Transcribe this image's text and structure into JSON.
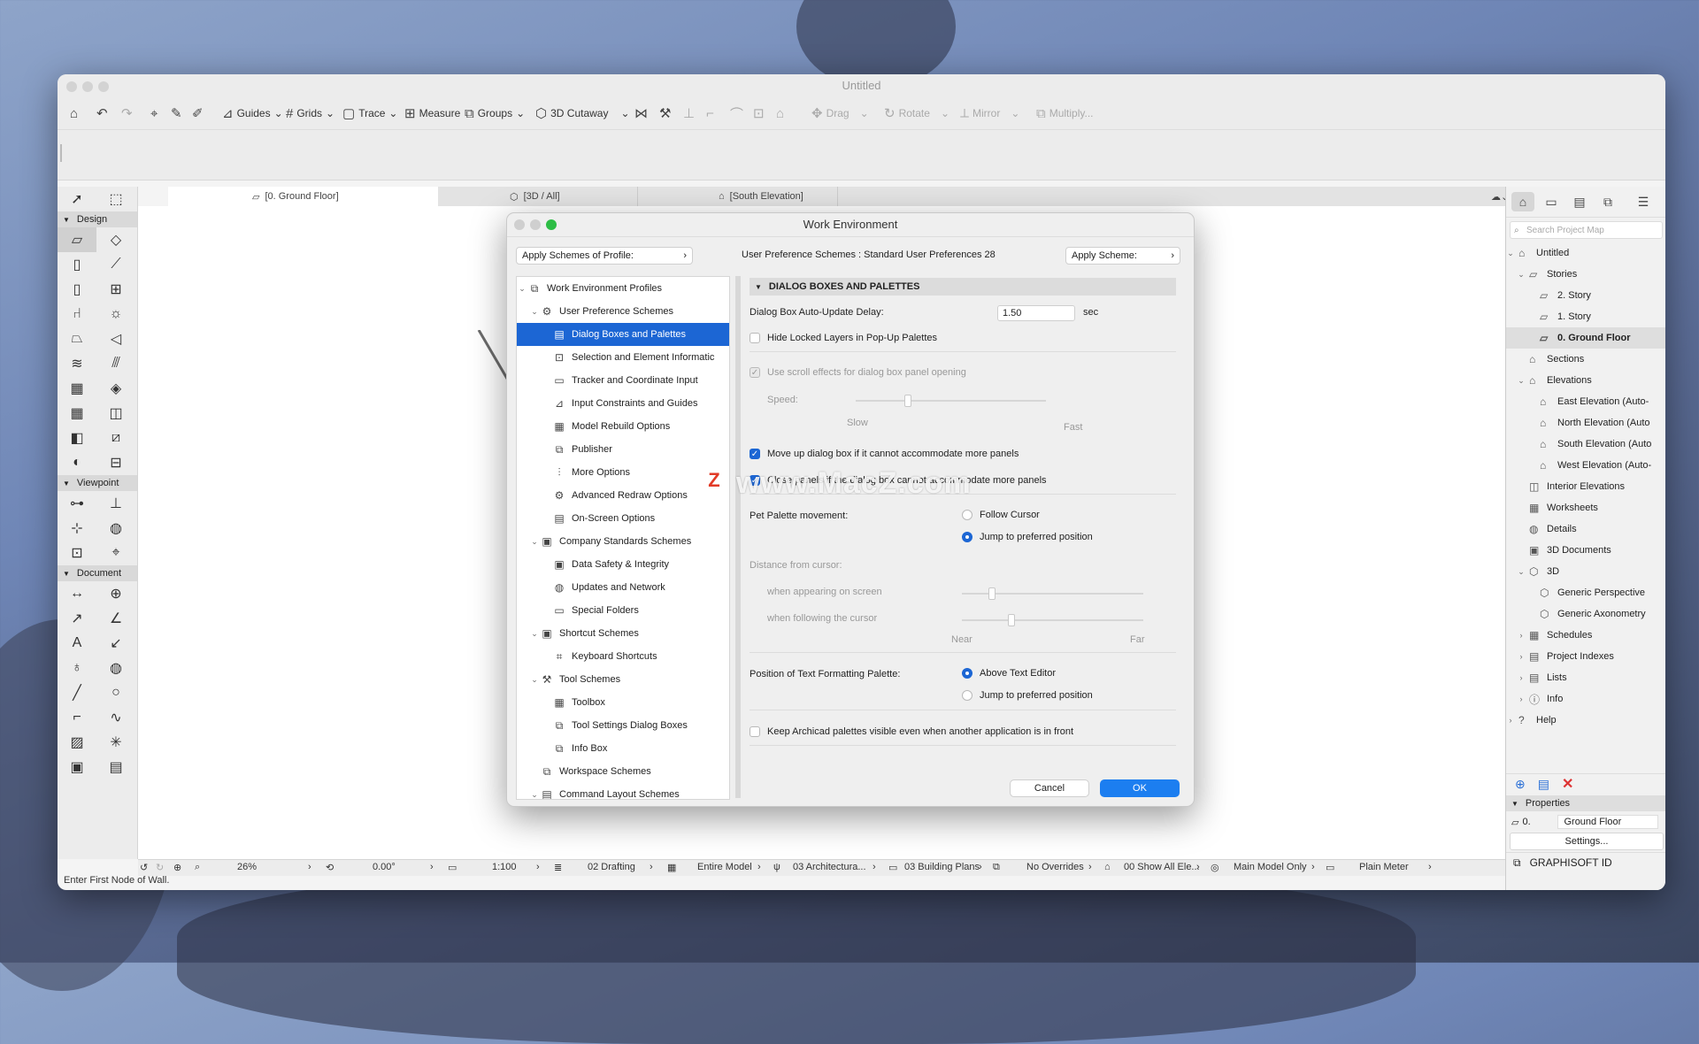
{
  "window": {
    "title": "Untitled",
    "status_text": "Enter First Node of Wall."
  },
  "toolbar": {
    "guides": "Guides",
    "grids": "Grids",
    "trace": "Trace",
    "measure": "Measure",
    "groups": "Groups",
    "cutaway": "3D Cutaway",
    "drag": "Drag",
    "rotate": "Rotate",
    "mirror": "Mirror",
    "multiply": "Multiply..."
  },
  "toolbox": {
    "design": "Design",
    "viewpoint": "Viewpoint",
    "document": "Document"
  },
  "tabs": [
    "[0. Ground Floor]",
    "[3D / All]",
    "[South Elevation]"
  ],
  "navigator": {
    "search_placeholder": "Search Project Map",
    "items": [
      "Untitled",
      "Stories",
      "2. Story",
      "1. Story",
      "0. Ground Floor",
      "Sections",
      "Elevations",
      "East Elevation (Auto-",
      "North Elevation (Auto",
      "South Elevation (Auto",
      "West Elevation (Auto-",
      "Interior Elevations",
      "Worksheets",
      "Details",
      "3D Documents",
      "3D",
      "Generic Perspective",
      "Generic Axonometry",
      "Schedules",
      "Project Indexes",
      "Lists",
      "Info",
      "Help"
    ],
    "properties_label": "Properties",
    "prop_id": "0.",
    "prop_value": "Ground Floor",
    "settings_label": "Settings...",
    "graphisoft_label": "GRAPHISOFT ID"
  },
  "statusbar": {
    "zoom": "26%",
    "angle": "0.00°",
    "scale": "1:100",
    "layer_combo": "02 Drafting",
    "model_view": "Entire Model",
    "pen_set": "03 Architectura...",
    "view_set": "03 Building Plans",
    "overrides": "No Overrides",
    "renovation": "00 Show All Ele...",
    "model_filter": "Main Model Only",
    "dimension": "Plain Meter"
  },
  "dialog": {
    "title": "Work Environment",
    "apply_profile_label": "Apply Schemes of Profile:",
    "scheme_label": "User Preference Schemes : Standard User Preferences 28",
    "apply_scheme_label": "Apply Scheme:",
    "tree": [
      "Work Environment Profiles",
      "User Preference Schemes",
      "Dialog Boxes and Palettes",
      "Selection and Element Informatic",
      "Tracker and Coordinate Input",
      "Input Constraints and Guides",
      "Model Rebuild Options",
      "Publisher",
      "More Options",
      "Advanced Redraw Options",
      "On-Screen Options",
      "Company Standards Schemes",
      "Data Safety & Integrity",
      "Updates and Network",
      "Special Folders",
      "Shortcut Schemes",
      "Keyboard Shortcuts",
      "Tool Schemes",
      "Toolbox",
      "Tool Settings Dialog Boxes",
      "Info Box",
      "Workspace Schemes",
      "Command Layout Schemes"
    ],
    "section_title": "DIALOG BOXES AND PALETTES",
    "auto_update_label": "Dialog Box Auto-Update Delay:",
    "auto_update_value": "1.50",
    "auto_update_unit": "sec",
    "hide_locked_label": "Hide Locked Layers in Pop-Up Palettes",
    "scroll_effects_label": "Use scroll effects for dialog box panel opening",
    "speed_label": "Speed:",
    "speed_slow": "Slow",
    "speed_fast": "Fast",
    "move_up_label": "Move up dialog box if it cannot accommodate more panels",
    "close_panels_label": "Close panels if the dialog box cannot accommodate more panels",
    "pet_palette_label": "Pet Palette movement:",
    "pet_follow": "Follow Cursor",
    "pet_jump": "Jump to preferred position",
    "distance_label": "Distance from cursor:",
    "dist_appearing": "when appearing on screen",
    "dist_following": "when following the cursor",
    "dist_near": "Near",
    "dist_far": "Far",
    "text_palette_label": "Position of Text Formatting Palette:",
    "text_above": "Above Text Editor",
    "text_jump": "Jump to preferred position",
    "keep_visible_label": "Keep Archicad palettes visible even when another application is in front",
    "cancel": "Cancel",
    "ok": "OK"
  },
  "watermark": "www.MacZ.com"
}
